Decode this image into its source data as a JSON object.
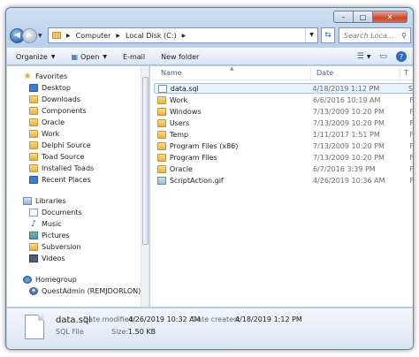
{
  "window": {
    "caption": {
      "minimize": "–",
      "maximize": "□",
      "close": "✕"
    }
  },
  "address": {
    "breadcrumbs": [
      "Computer",
      "Local Disk (C:)"
    ],
    "search_placeholder": "Search Loca..."
  },
  "toolbar": {
    "organize": "Organize",
    "open": "Open",
    "email": "E-mail",
    "new_folder": "New folder"
  },
  "nav": {
    "favorites": {
      "label": "Favorites",
      "items": [
        "Desktop",
        "Downloads",
        "Components",
        "Oracle",
        "Work",
        "Delphi Source",
        "Toad Source",
        "Installed Toads",
        "Recent Places"
      ]
    },
    "libraries": {
      "label": "Libraries",
      "items": [
        "Documents",
        "Music",
        "Pictures",
        "Subversion",
        "Videos"
      ]
    },
    "homegroup": {
      "label": "Homegroup",
      "items": [
        "QuestAdmin (REMJDORLON)"
      ]
    }
  },
  "columns": {
    "name": "Name",
    "date": "Date",
    "type": "T"
  },
  "files": [
    {
      "name": "data.sql",
      "date": "4/18/2019 1:12 PM",
      "type": "S",
      "kind": "file"
    },
    {
      "name": "Work",
      "date": "6/6/2016 10:19 AM",
      "type": "F",
      "kind": "folder"
    },
    {
      "name": "Windows",
      "date": "7/13/2009 10:20 PM",
      "type": "F",
      "kind": "folder"
    },
    {
      "name": "Users",
      "date": "7/13/2009 10:20 PM",
      "type": "F",
      "kind": "folder"
    },
    {
      "name": "Temp",
      "date": "1/11/2017 1:51 PM",
      "type": "F",
      "kind": "folder"
    },
    {
      "name": "Program Files (x86)",
      "date": "7/13/2009 10:20 PM",
      "type": "F",
      "kind": "folder"
    },
    {
      "name": "Program Files",
      "date": "7/13/2009 10:20 PM",
      "type": "F",
      "kind": "folder"
    },
    {
      "name": "Oracle",
      "date": "6/7/2016 3:39 PM",
      "type": "F",
      "kind": "folder"
    },
    {
      "name": "ScriptAction.gif",
      "date": "4/26/2019 10:36 AM",
      "type": "F",
      "kind": "gif"
    }
  ],
  "details": {
    "name": "data.sql",
    "type": "SQL File",
    "modified_label": "Date modified:",
    "modified_value": "4/26/2019 10:32 AM",
    "created_label": "Date created:",
    "created_value": "4/18/2019 1:12 PM",
    "size_label": "Size:",
    "size_value": "1.50 KB"
  }
}
